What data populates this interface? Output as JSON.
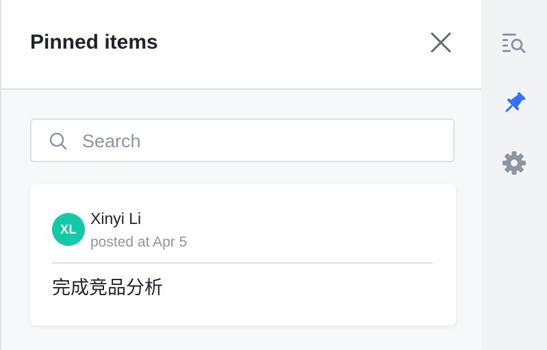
{
  "panel": {
    "title": "Pinned items",
    "close_icon": "close-icon"
  },
  "search": {
    "placeholder": "Search",
    "value": "",
    "icon": "search-icon"
  },
  "pinned_items": [
    {
      "avatar_initials": "XL",
      "avatar_color": "#14c9a8",
      "author": "Xinyi Li",
      "posted_at": "posted at Apr 5",
      "content": "完成竞品分析"
    }
  ],
  "rail": {
    "items": [
      {
        "icon": "search-messages-icon",
        "active": false,
        "color": "#8f959e"
      },
      {
        "icon": "pin-icon",
        "active": true,
        "color": "#3370ff"
      },
      {
        "icon": "gear-icon",
        "active": false,
        "color": "#8f959e"
      }
    ]
  },
  "colors": {
    "accent": "#3370ff",
    "avatar": "#14c9a8",
    "text_primary": "#1f2329",
    "text_secondary": "#8f959e"
  }
}
